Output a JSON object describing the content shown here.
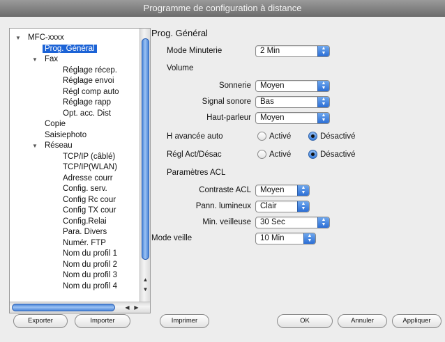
{
  "window": {
    "title": "Programme de configuration à distance"
  },
  "tree": {
    "items": [
      {
        "label": "MFC-xxxx",
        "level": 0,
        "expandable": true,
        "selected": false
      },
      {
        "label": "Prog. Général",
        "level": 1,
        "expandable": false,
        "selected": true
      },
      {
        "label": "Fax",
        "level": 1,
        "expandable": true,
        "selected": false
      },
      {
        "label": "Réglage récep.",
        "level": 2,
        "expandable": false,
        "selected": false
      },
      {
        "label": "Réglage envoi",
        "level": 2,
        "expandable": false,
        "selected": false
      },
      {
        "label": "Régl comp auto",
        "level": 2,
        "expandable": false,
        "selected": false
      },
      {
        "label": "Réglage rapp",
        "level": 2,
        "expandable": false,
        "selected": false
      },
      {
        "label": "Opt. acc. Dist",
        "level": 2,
        "expandable": false,
        "selected": false
      },
      {
        "label": "Copie",
        "level": 1,
        "expandable": false,
        "selected": false
      },
      {
        "label": "Saisiephoto",
        "level": 1,
        "expandable": false,
        "selected": false
      },
      {
        "label": "Réseau",
        "level": 1,
        "expandable": true,
        "selected": false
      },
      {
        "label": "TCP/IP (câblé)",
        "level": 2,
        "expandable": false,
        "selected": false
      },
      {
        "label": "TCP/IP(WLAN)",
        "level": 2,
        "expandable": false,
        "selected": false
      },
      {
        "label": "Adresse courr",
        "level": 2,
        "expandable": false,
        "selected": false
      },
      {
        "label": "Config. serv.",
        "level": 2,
        "expandable": false,
        "selected": false
      },
      {
        "label": "Config Rc cour",
        "level": 2,
        "expandable": false,
        "selected": false
      },
      {
        "label": "Config TX cour",
        "level": 2,
        "expandable": false,
        "selected": false
      },
      {
        "label": "Config.Relai",
        "level": 2,
        "expandable": false,
        "selected": false
      },
      {
        "label": "Para. Divers",
        "level": 2,
        "expandable": false,
        "selected": false
      },
      {
        "label": "Numér. FTP",
        "level": 2,
        "expandable": false,
        "selected": false
      },
      {
        "label": "Nom du profil 1",
        "level": 2,
        "expandable": false,
        "selected": false
      },
      {
        "label": "Nom du profil 2",
        "level": 2,
        "expandable": false,
        "selected": false
      },
      {
        "label": "Nom du profil 3",
        "level": 2,
        "expandable": false,
        "selected": false
      },
      {
        "label": "Nom du profil 4",
        "level": 2,
        "expandable": false,
        "selected": false
      }
    ]
  },
  "settings": {
    "title": "Prog. Général",
    "mode_minuterie": {
      "label": "Mode Minuterie",
      "value": "2 Min"
    },
    "volume_label": "Volume",
    "sonnerie": {
      "label": "Sonnerie",
      "value": "Moyen"
    },
    "signal_sonore": {
      "label": "Signal sonore",
      "value": "Bas"
    },
    "haut_parleur": {
      "label": "Haut-parleur",
      "value": "Moyen"
    },
    "h_avancee": {
      "label": "H avancée auto",
      "opt_on": "Activé",
      "opt_off": "Désactivé",
      "selected": "Désactivé"
    },
    "regl_act": {
      "label": "Régl Act/Désac",
      "opt_on": "Activé",
      "opt_off": "Désactivé",
      "selected": "Désactivé"
    },
    "acl_label": "Paramètres ACL",
    "contraste": {
      "label": "Contraste ACL",
      "value": "Moyen"
    },
    "pann_lumineux": {
      "label": "Pann. lumineux",
      "value": "Clair"
    },
    "min_veilleuse": {
      "label": "Min. veilleuse",
      "value": "30 Sec"
    },
    "mode_veille": {
      "label": "Mode veille",
      "value": "10 Min"
    }
  },
  "buttons": {
    "exporter": "Exporter",
    "importer": "Importer",
    "imprimer": "Imprimer",
    "ok": "OK",
    "annuler": "Annuler",
    "appliquer": "Appliquer"
  },
  "icons": {
    "disclosure": "disclosure-triangle-icon",
    "popup": "popup-arrows-icon",
    "scroll_up": "scroll-up-arrow-icon",
    "scroll_down": "scroll-down-arrow-icon",
    "scroll_left": "scroll-left-arrow-icon",
    "scroll_right": "scroll-right-arrow-icon"
  },
  "colors": {
    "selection": "#1c63d6",
    "accent_blue": "#3c7fdc"
  }
}
